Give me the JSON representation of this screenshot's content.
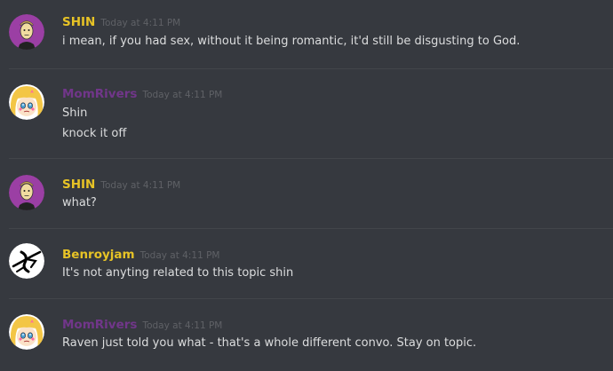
{
  "colors": {
    "background": "#36393f",
    "divider": "#42454a",
    "message_text": "#dcddde",
    "timestamp": "#5f6166",
    "shin": "#e7c326",
    "momrivers": "#71368a",
    "benroyjam": "#e7c326"
  },
  "messages": [
    {
      "avatar": "shin-avatar-icon",
      "author": "SHIN",
      "timestamp": "Today at 4:11 PM",
      "lines": [
        "i mean, if you had sex, without it being romantic, it'd still be disgusting to God."
      ]
    },
    {
      "avatar": "momrivers-avatar-icon",
      "author": "MomRivers",
      "timestamp": "Today at 4:11 PM",
      "lines": [
        "Shin",
        "knock it off"
      ]
    },
    {
      "avatar": "shin-avatar-icon",
      "author": "SHIN",
      "timestamp": "Today at 4:11 PM",
      "lines": [
        "what?"
      ]
    },
    {
      "avatar": "benroyjam-avatar-icon",
      "author": "Benroyjam",
      "timestamp": "Today at 4:11 PM",
      "lines": [
        "It's not anyting related to this topic shin"
      ]
    },
    {
      "avatar": "momrivers-avatar-icon",
      "author": "MomRivers",
      "timestamp": "Today at 4:11 PM",
      "lines": [
        "Raven just told you what - that's a whole different convo. Stay on topic."
      ]
    }
  ]
}
